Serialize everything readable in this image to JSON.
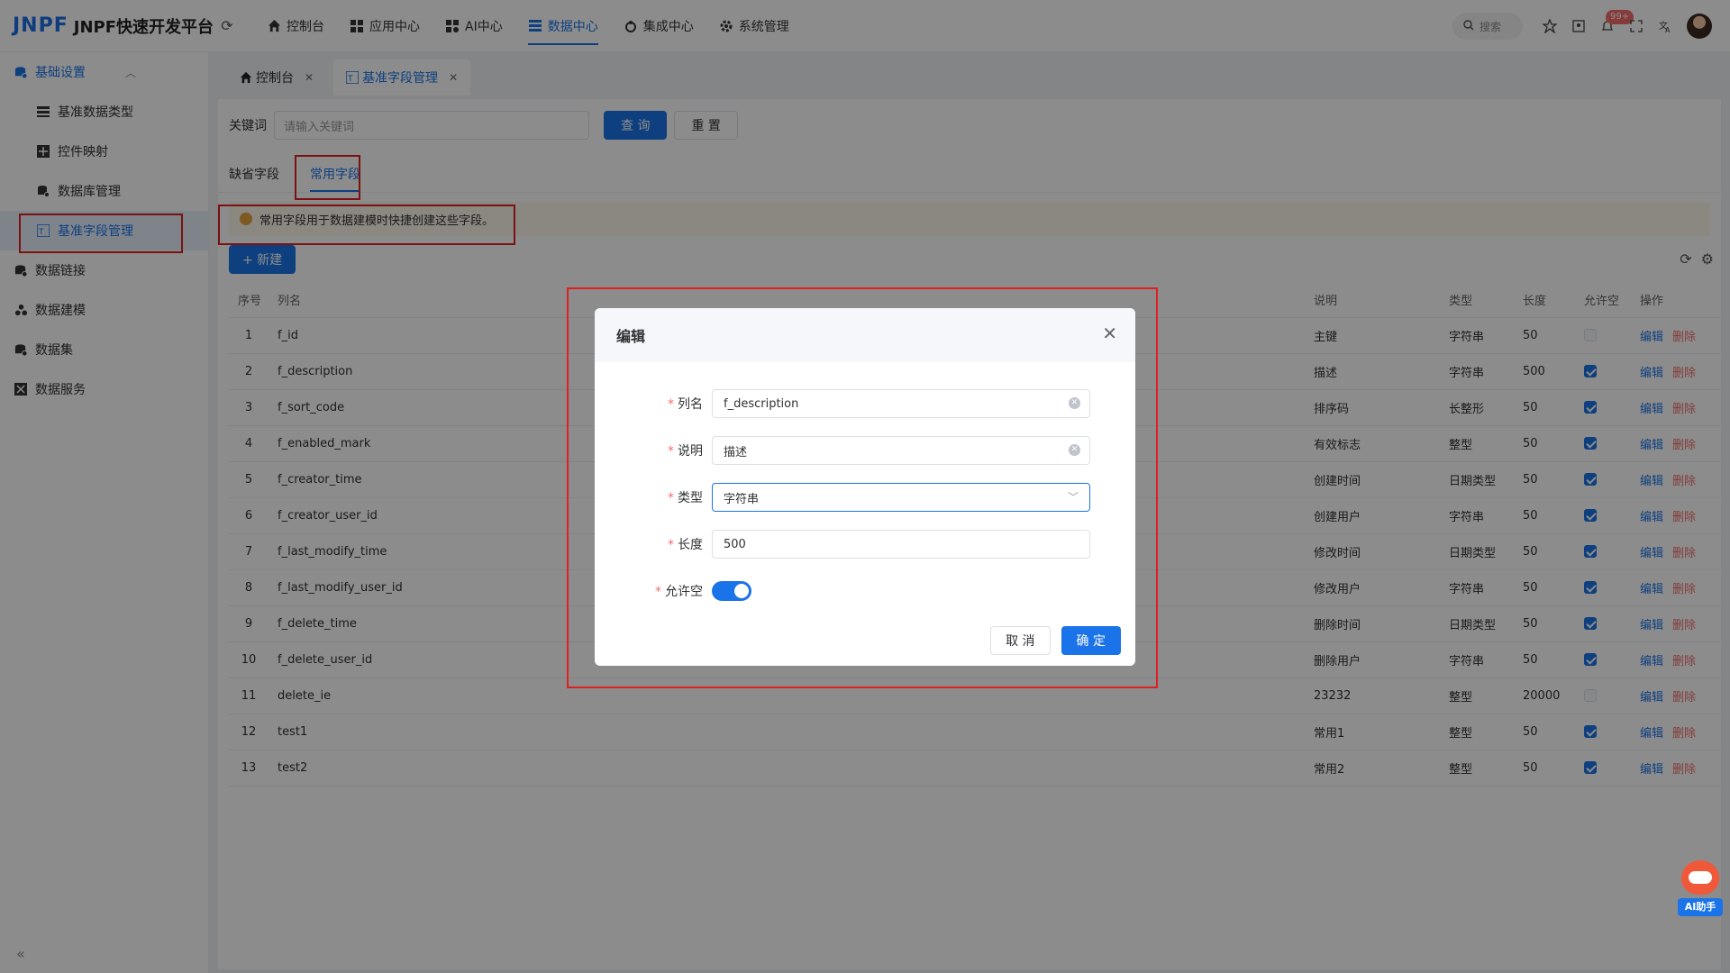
{
  "app": {
    "logo_mark": "JNPF",
    "title": "JNPF快速开发平台"
  },
  "topnav": [
    {
      "label": "控制台",
      "icon": "home-icon"
    },
    {
      "label": "应用中心",
      "icon": "grid-icon"
    },
    {
      "label": "AI中心",
      "icon": "ai-grid-icon"
    },
    {
      "label": "数据中心",
      "icon": "data-icon"
    },
    {
      "label": "集成中心",
      "icon": "integration-icon"
    },
    {
      "label": "系统管理",
      "icon": "gear-icon"
    }
  ],
  "topright": {
    "search_placeholder": "搜索",
    "badge": "99+"
  },
  "sidebar": {
    "group": "基础设置",
    "sub_items": [
      "基准数据类型",
      "控件映射",
      "数据库管理",
      "基准字段管理"
    ],
    "items": [
      "数据链接",
      "数据建模",
      "数据集",
      "数据服务"
    ],
    "collapse": "«"
  },
  "tabs": [
    {
      "label": "控制台"
    },
    {
      "label": "基准字段管理"
    }
  ],
  "search": {
    "label": "关键词",
    "placeholder": "请输入关键词",
    "query_btn": "查 询",
    "reset_btn": "重 置"
  },
  "subtabs": [
    "缺省字段",
    "常用字段"
  ],
  "alert": "常用字段用于数据建模时快捷创建这些字段。",
  "toolbar": {
    "new_btn": "+ 新建"
  },
  "table": {
    "headers": {
      "index": "序号",
      "name": "列名",
      "desc": "说明",
      "type": "类型",
      "length": "长度",
      "nullable": "允许空",
      "ops": "操作"
    },
    "edit": "编辑",
    "del": "删除",
    "rows": [
      {
        "index": "1",
        "name": "f_id",
        "desc": "主键",
        "type": "字符串",
        "length": "50",
        "nullable": false
      },
      {
        "index": "2",
        "name": "f_description",
        "desc": "描述",
        "type": "字符串",
        "length": "500",
        "nullable": true
      },
      {
        "index": "3",
        "name": "f_sort_code",
        "desc": "排序码",
        "type": "长整形",
        "length": "50",
        "nullable": true
      },
      {
        "index": "4",
        "name": "f_enabled_mark",
        "desc": "有效标志",
        "type": "整型",
        "length": "50",
        "nullable": true
      },
      {
        "index": "5",
        "name": "f_creator_time",
        "desc": "创建时间",
        "type": "日期类型",
        "length": "50",
        "nullable": true
      },
      {
        "index": "6",
        "name": "f_creator_user_id",
        "desc": "创建用户",
        "type": "字符串",
        "length": "50",
        "nullable": true
      },
      {
        "index": "7",
        "name": "f_last_modify_time",
        "desc": "修改时间",
        "type": "日期类型",
        "length": "50",
        "nullable": true
      },
      {
        "index": "8",
        "name": "f_last_modify_user_id",
        "desc": "修改用户",
        "type": "字符串",
        "length": "50",
        "nullable": true
      },
      {
        "index": "9",
        "name": "f_delete_time",
        "desc": "删除时间",
        "type": "日期类型",
        "length": "50",
        "nullable": true
      },
      {
        "index": "10",
        "name": "f_delete_user_id",
        "desc": "删除用户",
        "type": "字符串",
        "length": "50",
        "nullable": true
      },
      {
        "index": "11",
        "name": "delete_ie",
        "desc": "23232",
        "type": "整型",
        "length": "20000",
        "nullable": false
      },
      {
        "index": "12",
        "name": "test1",
        "desc": "常用1",
        "type": "整型",
        "length": "50",
        "nullable": true
      },
      {
        "index": "13",
        "name": "test2",
        "desc": "常用2",
        "type": "整型",
        "length": "50",
        "nullable": true
      }
    ]
  },
  "dialog": {
    "title": "编辑",
    "fields": {
      "name_label": "列名",
      "name_value": "f_description",
      "desc_label": "说明",
      "desc_value": "描述",
      "type_label": "类型",
      "type_value": "字符串",
      "length_label": "长度",
      "length_value": "500",
      "nullable_label": "允许空"
    },
    "cancel": "取 消",
    "ok": "确 定"
  },
  "ai_assistant": "AI助手",
  "colors": {
    "accent": "#1a73e8",
    "danger": "#f56c6c",
    "warning": "#e6a23c"
  }
}
